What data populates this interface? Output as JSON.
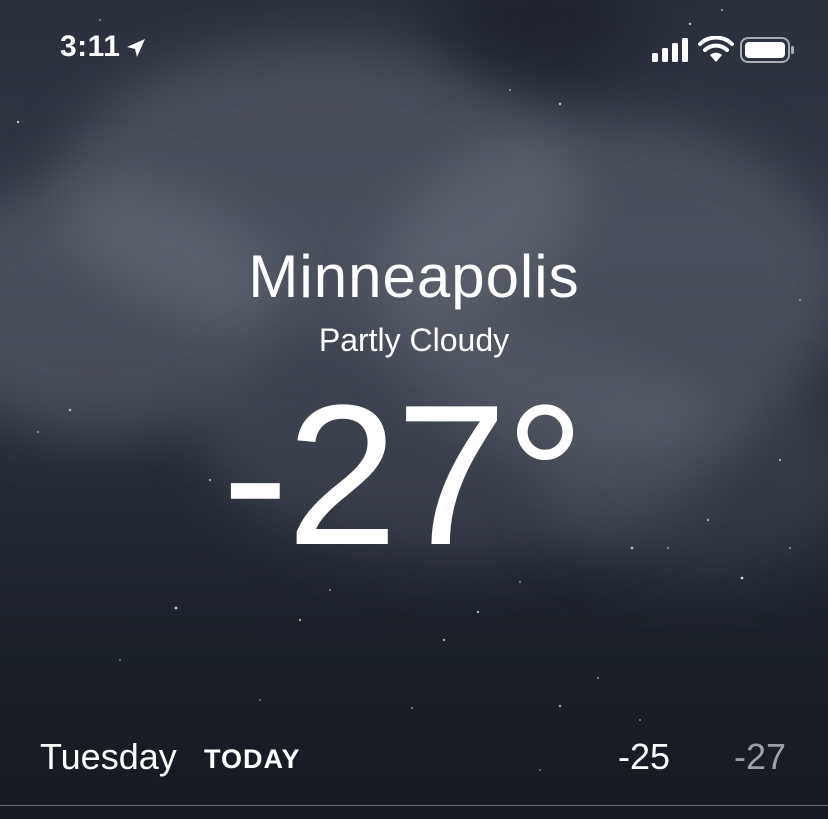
{
  "status_bar": {
    "time": "3:11",
    "icons": [
      "location-arrow-icon",
      "cellular-signal-icon",
      "wifi-icon",
      "battery-icon"
    ]
  },
  "weather": {
    "city": "Minneapolis",
    "condition": "Partly Cloudy",
    "temperature": "-27°"
  },
  "today": {
    "day": "Tuesday",
    "badge": "TODAY",
    "high": "-25",
    "low": "-27"
  },
  "colors": {
    "text": "#ffffff",
    "low_temp": "#9a9fa8",
    "background": "#1a1f2a"
  }
}
